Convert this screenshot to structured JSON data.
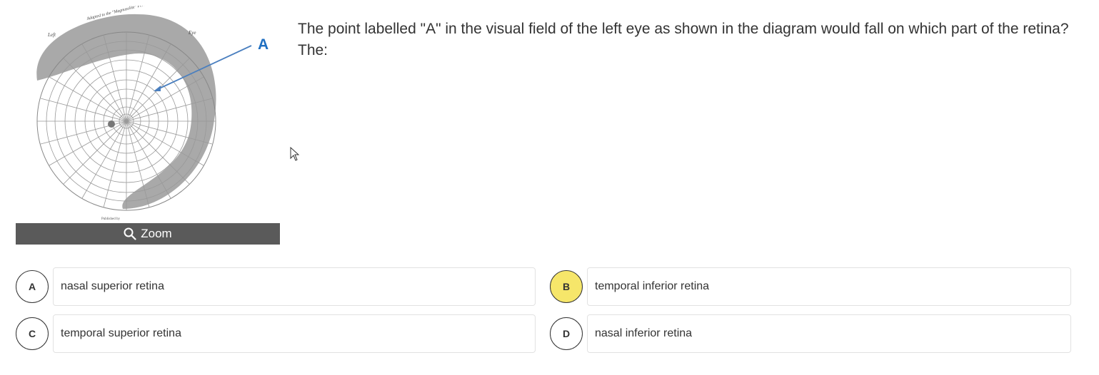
{
  "figure": {
    "callout_label": "A",
    "zoom_label": "Zoom",
    "chart_labels": {
      "left": "Left",
      "eye": "Eye",
      "title": "Adapted to the \"Magnusolite\" Perimeter",
      "publisher": "Published by"
    }
  },
  "question": {
    "text": "The point labelled \"A\" in the visual field of the left eye as shown in the diagram would fall on which part of the retina?  The:"
  },
  "options": [
    {
      "letter": "A",
      "text": "nasal superior retina",
      "selected": false
    },
    {
      "letter": "B",
      "text": "temporal inferior retina",
      "selected": true
    },
    {
      "letter": "C",
      "text": "temporal superior retina",
      "selected": false
    },
    {
      "letter": "D",
      "text": "nasal inferior retina",
      "selected": false
    }
  ],
  "colors": {
    "callout": "#1f6fc1",
    "selected_badge": "#f6e66a",
    "zoom_bar": "#5a5a5a"
  }
}
